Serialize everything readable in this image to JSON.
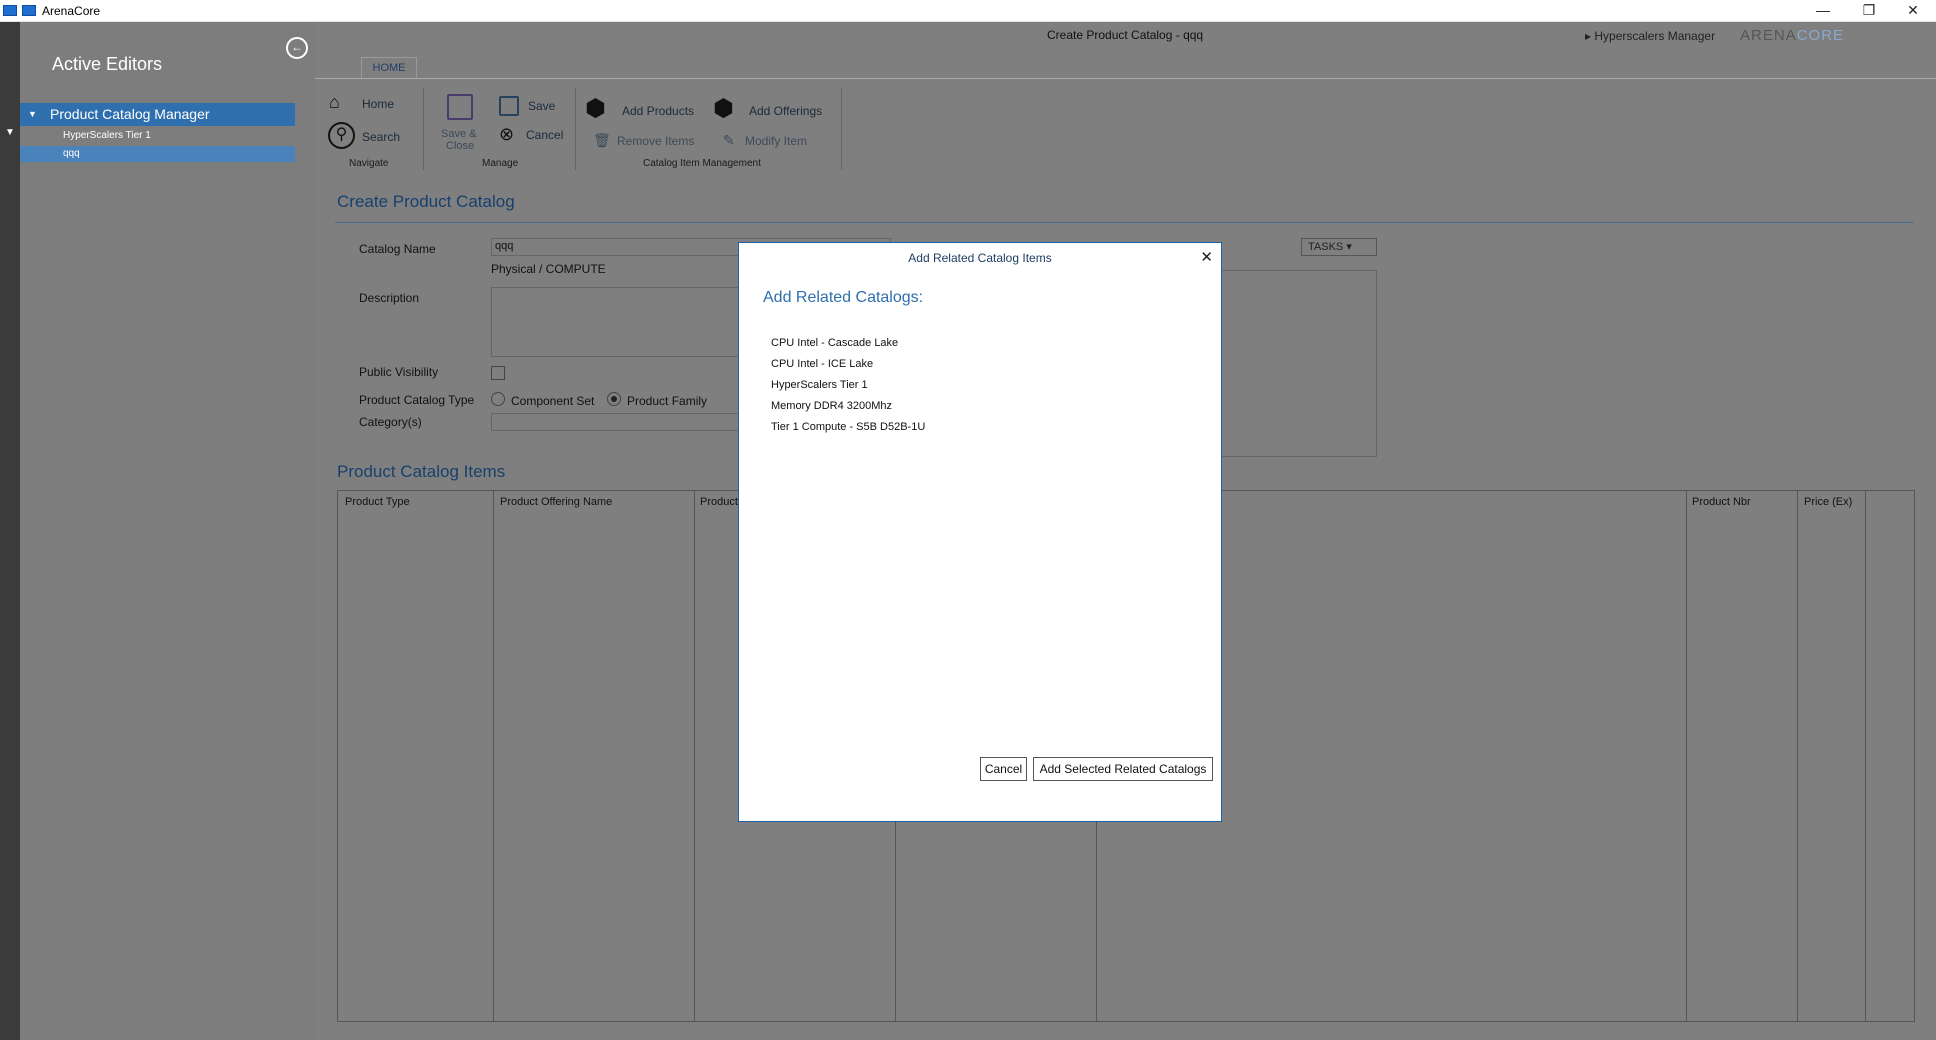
{
  "window": {
    "title": "ArenaCore",
    "minimize": "—",
    "restore": "❐",
    "close": "✕"
  },
  "sidebar": {
    "title": "Active Editors",
    "back_icon": "←",
    "group_label": "Product Catalog Manager",
    "items": [
      {
        "label": "HyperScalers Tier 1"
      },
      {
        "label": "qqq"
      }
    ]
  },
  "header": {
    "document_title": "Create Product Catalog - qqq",
    "breadcrumb": "Hyperscalers Manager",
    "logo_arena": "ARENA",
    "logo_core": "CORE"
  },
  "ribbon": {
    "tab": "HOME",
    "home": "Home",
    "search": "Search",
    "save_close": "Save &",
    "save_close2": "Close",
    "save": "Save",
    "cancel": "Cancel",
    "add_products": "Add Products",
    "add_offerings": "Add Offerings",
    "remove_items": "Remove Items",
    "modify_item": "Modify Item",
    "group_navigate": "Navigate",
    "group_manage": "Manage",
    "group_catalog": "Catalog Item Management"
  },
  "form": {
    "section_title": "Create Product Catalog",
    "catalog_name_label": "Catalog Name",
    "catalog_name_value": "qqq",
    "catalog_type_note": "Physical / COMPUTE",
    "description_label": "Description",
    "public_visibility_label": "Public Visibility",
    "catalog_type_label": "Product Catalog Type",
    "type_component": "Component Set",
    "type_family": "Product Family",
    "categories_label": "Category(s)",
    "tasks": "TASKS"
  },
  "items_grid": {
    "section_title": "Product Catalog Items",
    "columns": [
      "Product Type",
      "Product Offering Name",
      "Product",
      "Product Nbr",
      "Price (Ex)"
    ]
  },
  "modal": {
    "title": "Add Related Catalog Items",
    "heading": "Add Related Catalogs:",
    "items": [
      "CPU Intel - Cascade Lake",
      "CPU Intel - ICE Lake",
      "HyperScalers Tier 1",
      "Memory DDR4 3200Mhz",
      "Tier 1 Compute - S5B D52B-1U"
    ],
    "cancel": "Cancel",
    "add": "Add Selected Related Catalogs",
    "close_icon": "✕"
  },
  "colors": {
    "accent": "#2f6fae",
    "overlay": "#7f7f7f",
    "sidebar": "#7d7d7d"
  }
}
